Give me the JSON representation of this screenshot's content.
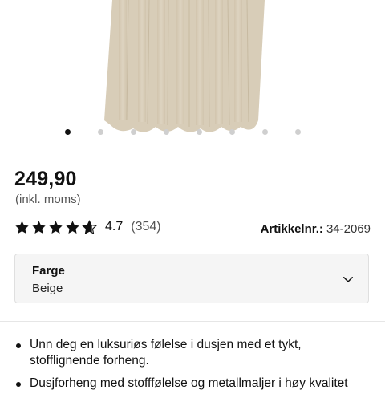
{
  "product": {
    "price": "249,90",
    "vat_note": "(inkl. moms)",
    "rating": {
      "stars": 4.7,
      "value": "4.7",
      "count": "(354)"
    },
    "article": {
      "label": "Artikkelnr.:",
      "value": "34-2069"
    }
  },
  "carousel": {
    "total": 8,
    "active_index": 0
  },
  "color_select": {
    "label": "Farge",
    "value": "Beige",
    "icon": "chevron-down-icon"
  },
  "description": {
    "bullets": [
      "Unn deg en luksuriøs følelse i dusjen med et tykt, stofflignende forheng.",
      "Dusjforheng med stofffølelse og metallmaljer i høy kvalitet"
    ]
  },
  "colors": {
    "curtain": "#d8cdb8",
    "star": "#111111",
    "dot_active": "#111111",
    "dot_inactive": "#cfcfcf"
  }
}
